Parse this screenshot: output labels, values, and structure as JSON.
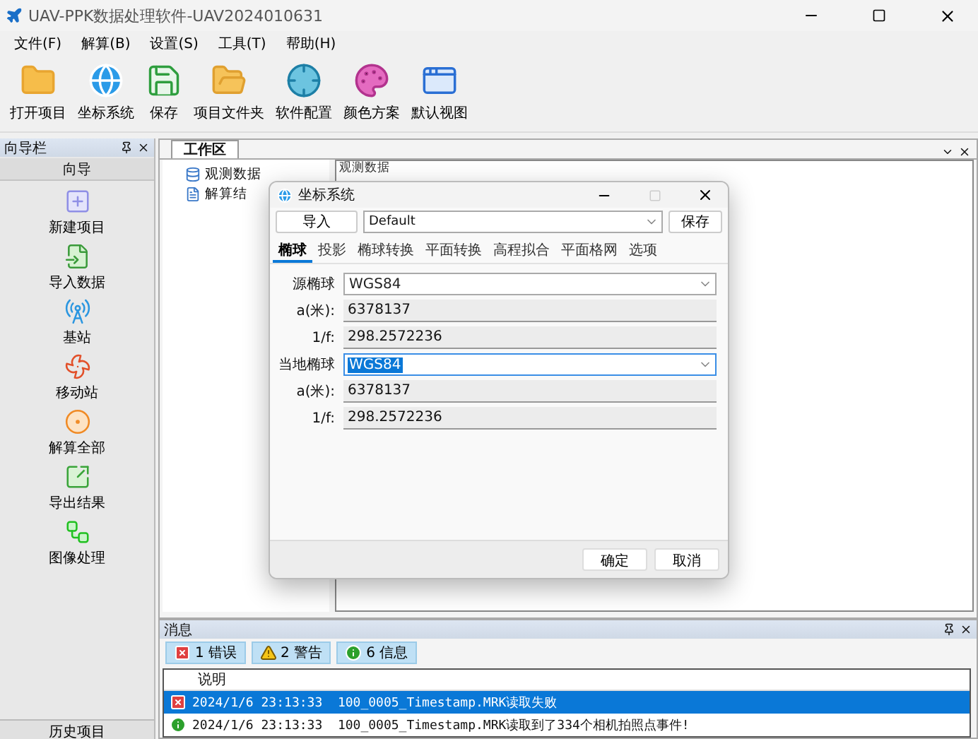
{
  "window": {
    "title": "UAV-PPK数据处理软件-UAV2024010631"
  },
  "menu": [
    "文件(F)",
    "解算(B)",
    "设置(S)",
    "工具(T)",
    "帮助(H)"
  ],
  "toolbar": [
    {
      "kind": "folder",
      "label": "打开项目"
    },
    {
      "kind": "globe",
      "label": "坐标系统"
    },
    {
      "kind": "save",
      "label": "保存"
    },
    {
      "kind": "folder-doc",
      "label": "项目文件夹"
    },
    {
      "kind": "config",
      "label": "软件配置"
    },
    {
      "kind": "palette",
      "label": "颜色方案"
    },
    {
      "kind": "layout",
      "label": "默认视图"
    }
  ],
  "sidebar": {
    "title": "向导栏",
    "section": "向导",
    "items": [
      {
        "kind": "new",
        "label": "新建项目"
      },
      {
        "kind": "import",
        "label": "导入数据"
      },
      {
        "kind": "base",
        "label": "基站"
      },
      {
        "kind": "rover",
        "label": "移动站"
      },
      {
        "kind": "solve",
        "label": "解算全部"
      },
      {
        "kind": "export",
        "label": "导出结果"
      },
      {
        "kind": "image",
        "label": "图像处理"
      }
    ],
    "footer": "历史项目"
  },
  "workspace": {
    "tab": "工作区",
    "tree": [
      {
        "kind": "data",
        "label": "观测数据"
      },
      {
        "kind": "result",
        "label": "解算结"
      }
    ],
    "panel_title": "观测数据"
  },
  "dialog": {
    "title": "坐标系统",
    "import_button": "导入",
    "profile": "Default",
    "save_button": "保存",
    "tabs": [
      {
        "label": "椭球",
        "selected": true
      },
      {
        "label": "投影",
        "selected": false
      },
      {
        "label": "椭球转换",
        "selected": false
      },
      {
        "label": "平面转换",
        "selected": false
      },
      {
        "label": "高程拟合",
        "selected": false
      },
      {
        "label": "平面格网",
        "selected": false
      },
      {
        "label": "选项",
        "selected": false
      }
    ],
    "fields": [
      {
        "kind": "select",
        "label": "源椭球",
        "value": "WGS84",
        "focused": false
      },
      {
        "kind": "readonly",
        "label": "a(米):",
        "value": "6378137"
      },
      {
        "kind": "readonly",
        "label": "1/f:",
        "value": "298.2572236"
      },
      {
        "kind": "select",
        "label": "当地椭球",
        "value": "WGS84",
        "focused": true
      },
      {
        "kind": "readonly",
        "label": "a(米):",
        "value": "6378137"
      },
      {
        "kind": "readonly",
        "label": "1/f:",
        "value": "298.2572236"
      }
    ],
    "buttons": [
      "确定",
      "取消"
    ]
  },
  "messages": {
    "title": "消息",
    "filters": [
      {
        "kind": "error",
        "label": "1 错误",
        "active": true
      },
      {
        "kind": "warning",
        "label": "2 警告",
        "active": true
      },
      {
        "kind": "info",
        "label": "6 信息",
        "active": true
      }
    ],
    "column": "说明",
    "rows": [
      {
        "kind": "error",
        "text": "2024/1/6 23:13:33  100_0005_Timestamp.MRK读取失败",
        "selected": true
      },
      {
        "kind": "info",
        "text": "2024/1/6 23:13:33  100_0005_Timestamp.MRK读取到了334个相机拍照点事件!",
        "selected": false
      }
    ]
  }
}
